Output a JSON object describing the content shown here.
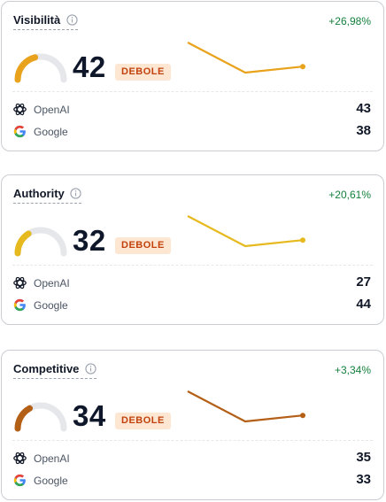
{
  "cards": [
    {
      "title": "Visibilità",
      "change": "+26,98%",
      "score": "42",
      "score_fraction": 0.42,
      "badge": "DEBOLE",
      "color": "#e9a21b",
      "trend": [
        3,
        1,
        1.4
      ],
      "sources": [
        {
          "name": "OpenAI",
          "value": "43"
        },
        {
          "name": "Google",
          "value": "38"
        }
      ]
    },
    {
      "title": "Authority",
      "change": "+20,61%",
      "score": "32",
      "score_fraction": 0.32,
      "badge": "DEBOLE",
      "color": "#e6b91e",
      "trend": [
        3,
        1,
        1.4
      ],
      "sources": [
        {
          "name": "OpenAI",
          "value": "27"
        },
        {
          "name": "Google",
          "value": "44"
        }
      ]
    },
    {
      "title": "Competitive",
      "change": "+3,34%",
      "score": "34",
      "score_fraction": 0.34,
      "badge": "DEBOLE",
      "color": "#b45f16",
      "trend": [
        3,
        1,
        1.4
      ],
      "sources": [
        {
          "name": "OpenAI",
          "value": "35"
        },
        {
          "name": "Google",
          "value": "33"
        }
      ]
    }
  ],
  "colors": {
    "positive": "#15803d",
    "gauge_track": "#e5e7eb",
    "badge_bg": "#fde7d3",
    "badge_text": "#c2410c"
  },
  "icons": {
    "info": "info-icon",
    "openai": "openai-logo-icon",
    "google": "google-logo-icon"
  }
}
